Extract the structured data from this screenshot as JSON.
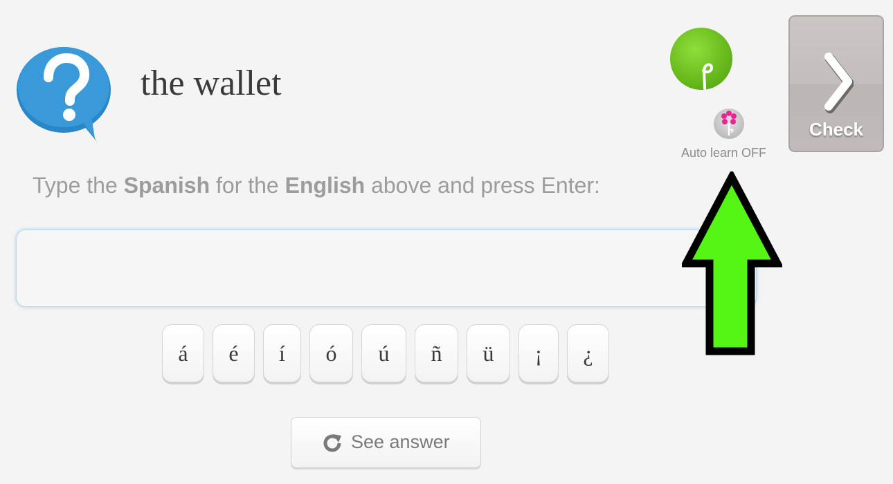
{
  "prompt": {
    "word": "the wallet"
  },
  "autolearn": {
    "label": "Auto learn OFF"
  },
  "check_button": {
    "label": "Check"
  },
  "instruction": {
    "part1": "Type the ",
    "language_to": "Spanish",
    "part2": " for the ",
    "language_from": "English",
    "part3": " above and press Enter:"
  },
  "answer_input": {
    "value": ""
  },
  "accent_keys": [
    "á",
    "é",
    "í",
    "ó",
    "ú",
    "ñ",
    "ü",
    "¡",
    "¿"
  ],
  "see_answer": {
    "label": "See answer"
  },
  "icons": {
    "question": "question-speech-bubble-icon",
    "plant": "seedling-plant-icon",
    "autolearn": "flower-icon",
    "check": "chevron-right-icon",
    "see_answer": "refresh-icon",
    "annotation": "up-arrow-annotation"
  },
  "colors": {
    "question_bubble": "#3a9ad9",
    "plant_circle": "#6fc21f",
    "check_button": "#c3bebd",
    "arrow_fill": "#55f516",
    "arrow_stroke": "#000000",
    "input_glow": "#7bb2de",
    "instruction_text": "#9c9c9c"
  }
}
